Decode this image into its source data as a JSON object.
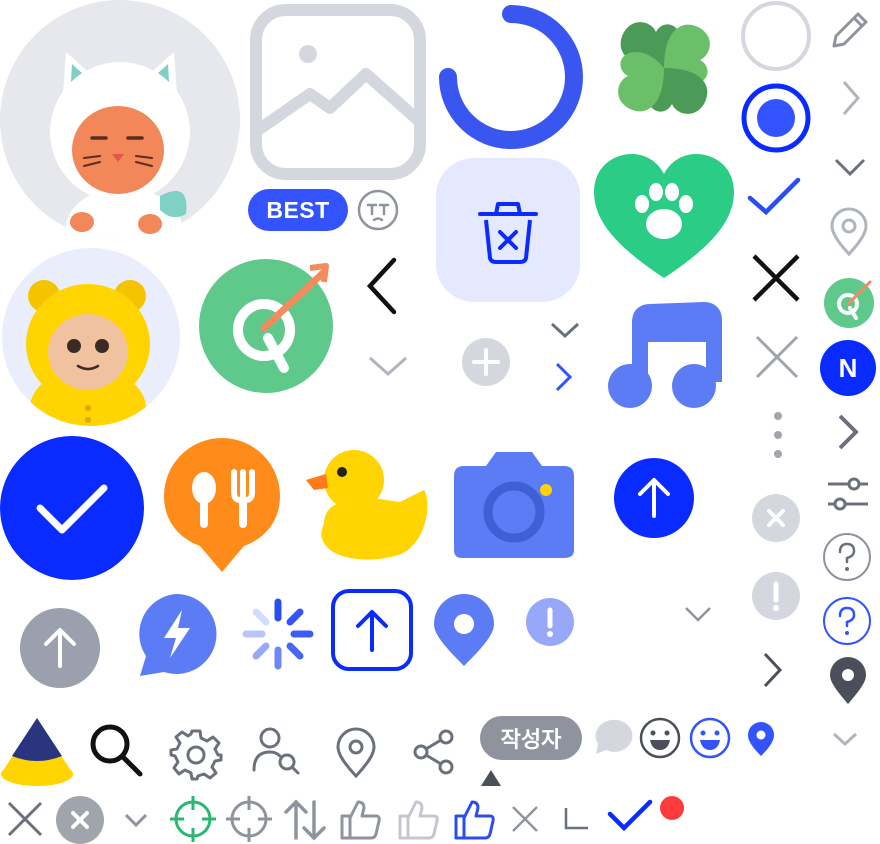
{
  "badges": {
    "best": "BEST",
    "author": "작성자",
    "n_logo": "N"
  },
  "colors": {
    "primary_blue": "#0a2bff",
    "accent_blue": "#3353ff",
    "soft_blue": "#5b7cf5",
    "green": "#4fbf7a",
    "gray": "#8e939e",
    "light_gray": "#d4d7de",
    "orange": "#ff8c1a",
    "yellow": "#ffd400",
    "red": "#ff3b3b"
  },
  "icons": [
    "cat-avatar",
    "image-placeholder-icon",
    "loading-ring-icon",
    "clover-icon",
    "radio-unchecked-icon",
    "pencil-icon",
    "chevron-right-icon",
    "radio-checked-icon",
    "chevron-down-icon",
    "checkmark-icon",
    "emoji-crying-icon",
    "trash-icon",
    "heart-paw-icon",
    "location-pin-outline-icon",
    "dart-target-icon",
    "close-icon",
    "bear-avatar",
    "plus-circle-icon",
    "music-note-icon",
    "n-logo-icon",
    "more-vertical-icon",
    "check-circle-icon",
    "restaurant-pin-icon",
    "duck-icon",
    "camera-icon",
    "arrow-up-circle-icon",
    "sliders-icon",
    "help-circle-icon",
    "lightning-chat-icon",
    "spinner-icon",
    "arrow-up-square-icon",
    "location-pin-icon",
    "exclamation-circle-icon",
    "cone-icon",
    "search-icon",
    "gear-icon",
    "user-search-icon",
    "share-icon",
    "triangle-up-icon",
    "chat-bubble-icon",
    "emoji-smile-icon",
    "crosshair-icon",
    "sort-icon",
    "thumbs-up-icon",
    "corner-icon",
    "notification-dot-icon"
  ]
}
